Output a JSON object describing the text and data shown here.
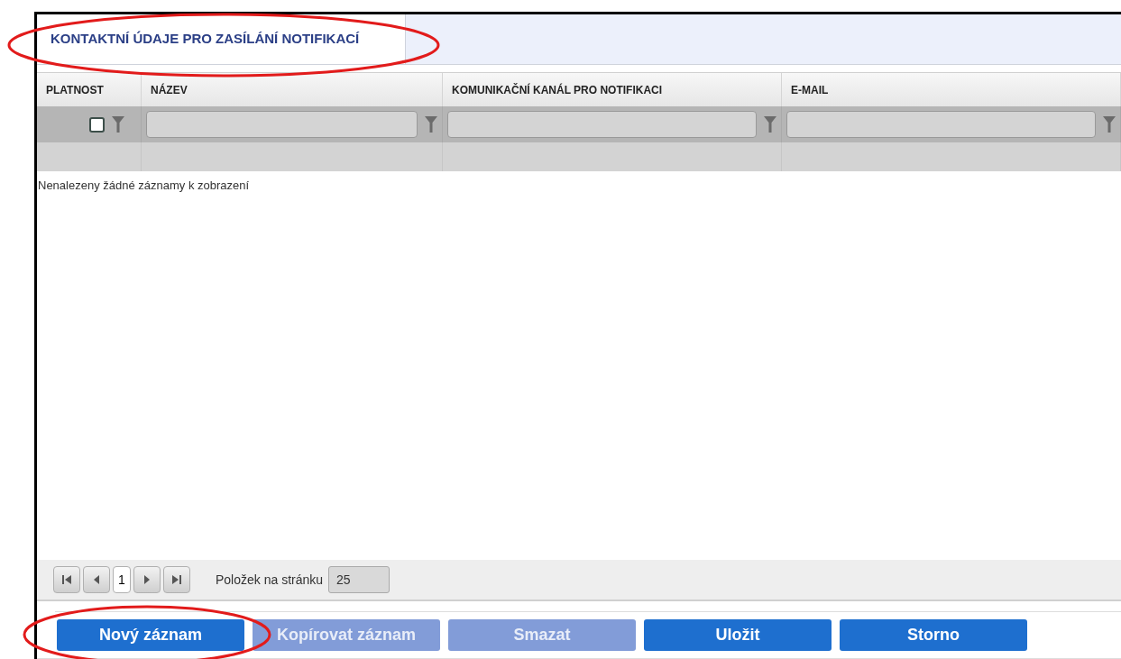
{
  "tabs": [
    {
      "label": "KONTAKTNÍ ÚDAJE PRO ZASÍLÁNÍ NOTIFIKACÍ",
      "selected": true
    }
  ],
  "table": {
    "columns": [
      {
        "label": "PLATNOST",
        "kind": "checkbox",
        "checked": false
      },
      {
        "label": "NÁZEV",
        "kind": "text"
      },
      {
        "label": "KOMUNIKAČNÍ KANÁL PRO NOTIFIKACI",
        "kind": "text"
      },
      {
        "label": "E-MAIL",
        "kind": "text"
      }
    ],
    "empty_message": "Nenalezeny žádné záznamy k zobrazení"
  },
  "pager": {
    "page": "1",
    "page_size_label": "Položek na stránku",
    "page_size": "25"
  },
  "buttons": [
    {
      "label": "Nový záznam",
      "disabled": false
    },
    {
      "label": "Kopírovat záznam",
      "disabled": true
    },
    {
      "label": "Smazat",
      "disabled": true
    },
    {
      "label": "Uložit",
      "disabled": false
    },
    {
      "label": "Storno",
      "disabled": false
    }
  ]
}
